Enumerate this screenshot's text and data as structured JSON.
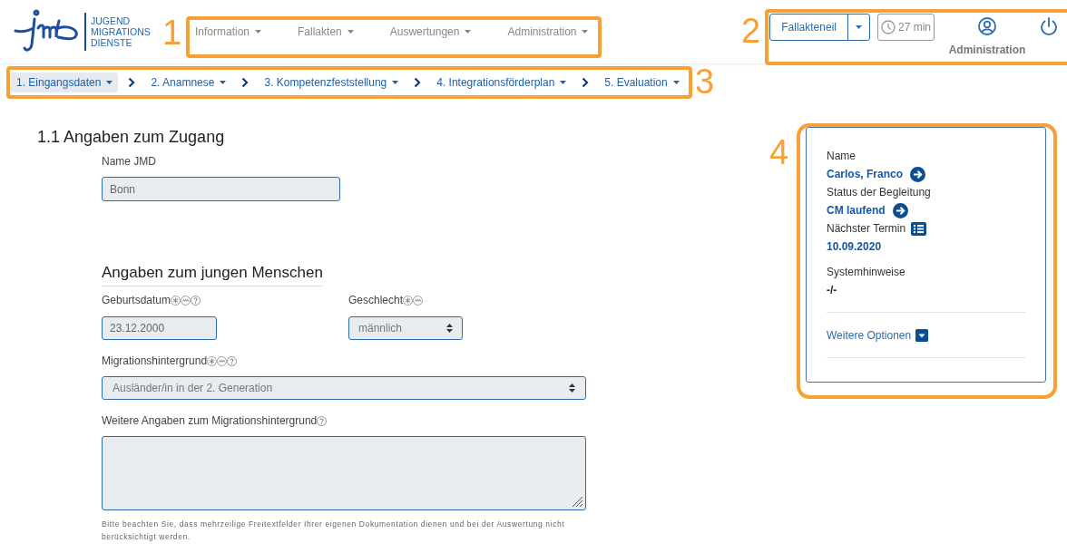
{
  "logo": {
    "lines": [
      "JUGEND",
      "MIGRATIONS",
      "DIENSTE"
    ]
  },
  "nav": [
    {
      "label": "Information"
    },
    {
      "label": "Fallakten"
    },
    {
      "label": "Auswertungen"
    },
    {
      "label": "Administration"
    }
  ],
  "toolbar": {
    "split_button": "Fallakteneil",
    "timer": "27 min",
    "user": "Administration"
  },
  "steps": [
    {
      "label": "1. Eingangsdaten",
      "selected": true
    },
    {
      "label": "2. Anamnese",
      "selected": false
    },
    {
      "label": "3. Kompetenzfeststellung",
      "selected": false
    },
    {
      "label": "4. Integrationsförderplan",
      "selected": false
    },
    {
      "label": "5. Evaluation",
      "selected": false
    }
  ],
  "section_title": "1.1 Angaben zum Zugang",
  "name_field": {
    "label": "Name JMD",
    "value": "Bonn"
  },
  "subsection_title": "Angaben zum jungen Menschen",
  "birth_field": {
    "label": "Geburtsdatum",
    "badges": [
      {
        "kind": "star"
      },
      {
        "kind": "sign"
      },
      {
        "kind": "help"
      }
    ],
    "value": "23.12.2000"
  },
  "gender_field": {
    "label": "Geschlecht",
    "badges": [
      {
        "kind": "star"
      },
      {
        "kind": "sign"
      }
    ],
    "value": "männlich"
  },
  "migration_field": {
    "label": "Migrationshintergrund",
    "badges": [
      {
        "kind": "star"
      },
      {
        "kind": "sign"
      },
      {
        "kind": "help"
      }
    ],
    "value": "Ausländer/in in der 2. Generation"
  },
  "details_field": {
    "label": "Weitere Angaben zum Migrationshintergrund",
    "badges": [
      {
        "kind": "help"
      }
    ]
  },
  "hint": "Bitte beachten Sie, dass mehrzeilige Freitextfelder Ihrer eigenen Dokumentation dienen und bei der Auswertung nicht berücksichtigt werden.",
  "info_panel": {
    "items": [
      {
        "label": "Name",
        "value": "Carlos, Franco",
        "kind": "arrowlink"
      },
      {
        "label": "Status der Begleitung",
        "value": "CM laufend",
        "kind": "arrowlink"
      },
      {
        "label": "Nächster Termin",
        "value": "10.09.2020",
        "kind": "listlink"
      },
      {
        "label": "Systemhinweise",
        "value": "-/-",
        "kind": "plain"
      }
    ],
    "more": "Weitere Optionen"
  },
  "annotations": [
    {
      "label": "1"
    },
    {
      "label": "2"
    },
    {
      "label": "3"
    },
    {
      "label": "4"
    }
  ]
}
